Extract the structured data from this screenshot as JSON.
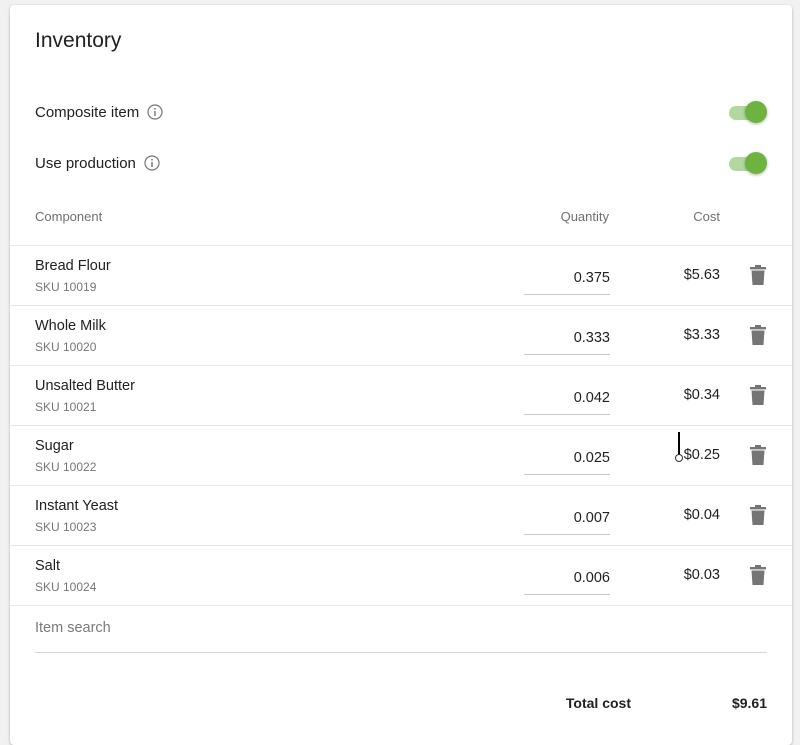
{
  "card": {
    "title": "Inventory"
  },
  "settings": {
    "composite_item": {
      "label": "Composite item",
      "enabled": true
    },
    "use_production": {
      "label": "Use production",
      "enabled": true
    }
  },
  "table": {
    "headers": {
      "component": "Component",
      "quantity": "Quantity",
      "cost": "Cost"
    },
    "rows": [
      {
        "name": "Bread Flour",
        "sku": "SKU 10019",
        "quantity": "0.375",
        "cost": "$5.63"
      },
      {
        "name": "Whole Milk",
        "sku": "SKU 10020",
        "quantity": "0.333",
        "cost": "$3.33"
      },
      {
        "name": "Unsalted Butter",
        "sku": "SKU 10021",
        "quantity": "0.042",
        "cost": "$0.34"
      },
      {
        "name": "Sugar",
        "sku": "SKU 10022",
        "quantity": "0.025",
        "cost": "$0.25"
      },
      {
        "name": "Instant Yeast",
        "sku": "SKU 10023",
        "quantity": "0.007",
        "cost": "$0.04"
      },
      {
        "name": "Salt",
        "sku": "SKU 10024",
        "quantity": "0.006",
        "cost": "$0.03"
      }
    ]
  },
  "search": {
    "placeholder": "Item search"
  },
  "totals": {
    "label": "Total cost",
    "value": "$9.61"
  },
  "colors": {
    "accent": "#6db33f",
    "track": "#b2d8a0",
    "icon": "#757575"
  }
}
